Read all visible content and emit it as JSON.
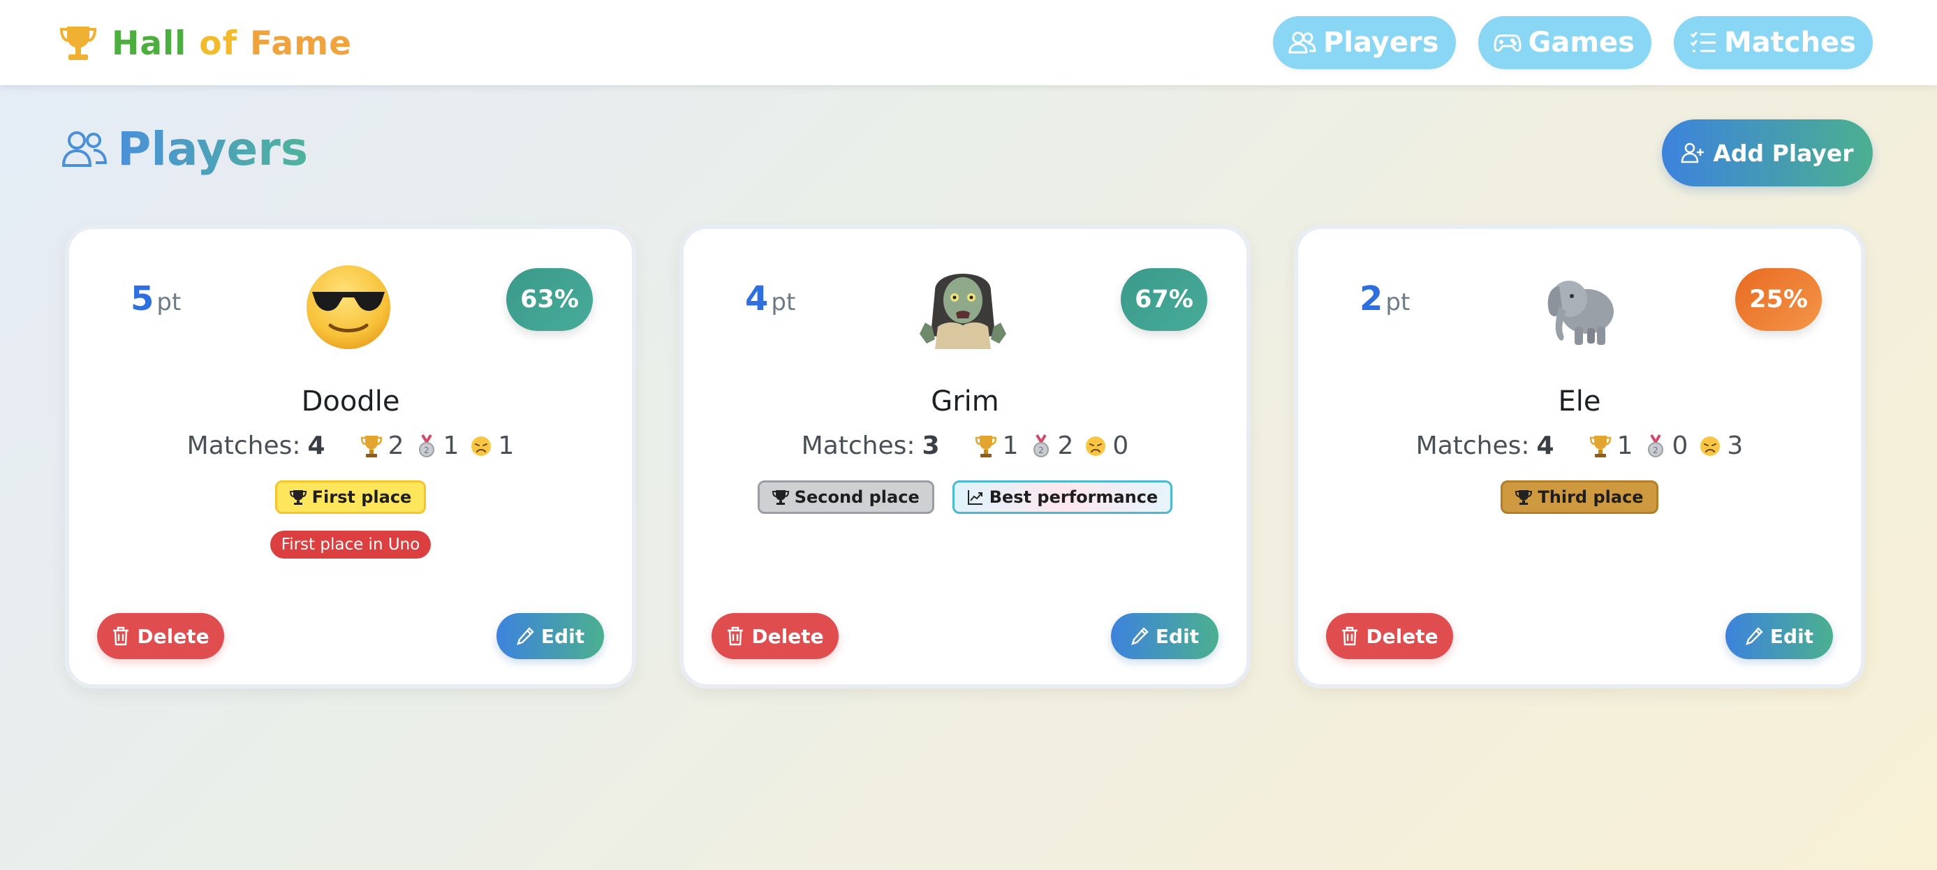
{
  "brand": {
    "icon": "trophy-icon",
    "words": [
      "Hall",
      "of",
      "Fame"
    ],
    "colors": {
      "hall": "#4cae3e",
      "of": "#f2bb2c",
      "fame": "#f0a23d"
    }
  },
  "nav": [
    {
      "label": "Players",
      "icon": "users-icon"
    },
    {
      "label": "Games",
      "icon": "gamepad-icon"
    },
    {
      "label": "Matches",
      "icon": "list-icon"
    }
  ],
  "page": {
    "title": "Players",
    "add_button": "Add Player"
  },
  "labels": {
    "matches": "Matches:",
    "points_unit": "pt",
    "delete": "Delete",
    "edit": "Edit"
  },
  "players": [
    {
      "name": "Doodle",
      "avatar": "sunglasses-face-emoji",
      "points": "5",
      "win_rate": "63%",
      "win_rate_color": "#3fa08f",
      "matches": "4",
      "gold": "2",
      "silver": "1",
      "losses": "1",
      "badges": [
        {
          "label": "First place",
          "kind": "gold"
        }
      ],
      "extra_badge": "First place in Uno"
    },
    {
      "name": "Grim",
      "avatar": "zombie-woman-emoji",
      "points": "4",
      "win_rate": "67%",
      "win_rate_color": "#3fa08f",
      "matches": "3",
      "gold": "1",
      "silver": "2",
      "losses": "0",
      "badges": [
        {
          "label": "Second place",
          "kind": "silver"
        },
        {
          "label": "Best performance",
          "kind": "perf"
        }
      ]
    },
    {
      "name": "Ele",
      "avatar": "elephant-emoji",
      "points": "2",
      "win_rate": "25%",
      "win_rate_color": "#ee7a2e",
      "matches": "4",
      "gold": "1",
      "silver": "0",
      "losses": "3",
      "badges": [
        {
          "label": "Third place",
          "kind": "bronze"
        }
      ]
    }
  ]
}
